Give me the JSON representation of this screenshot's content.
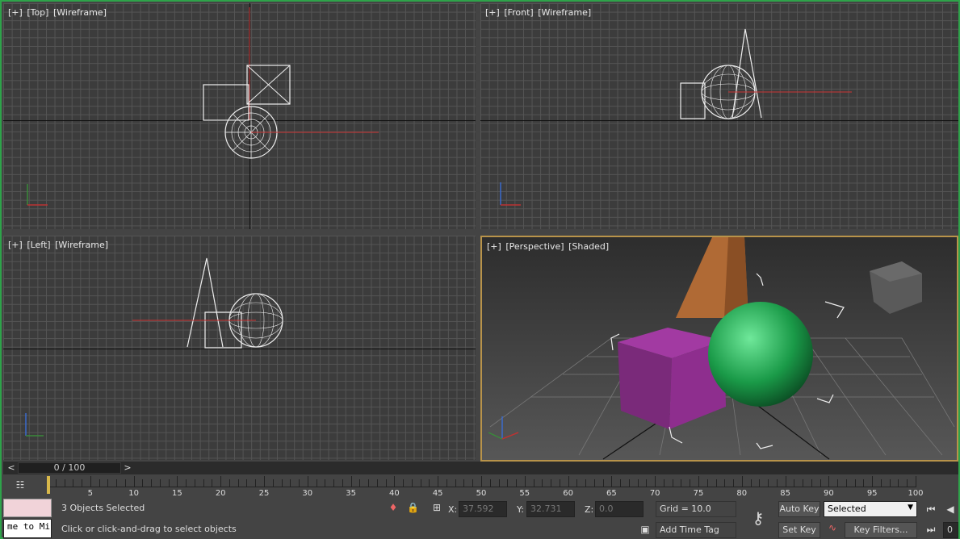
{
  "viewports": {
    "top": {
      "plus": "[+]",
      "name": "[Top]",
      "mode": "[Wireframe]"
    },
    "front": {
      "plus": "[+]",
      "name": "[Front]",
      "mode": "[Wireframe]"
    },
    "left": {
      "plus": "[+]",
      "name": "[Left]",
      "mode": "[Wireframe]"
    },
    "perspective": {
      "plus": "[+]",
      "name": "[Perspective]",
      "mode": "[Shaded]"
    }
  },
  "timeline": {
    "prev": "<",
    "next": ">",
    "frame": "0 / 100",
    "ticks": [
      "5",
      "10",
      "15",
      "20",
      "25",
      "30",
      "35",
      "40",
      "45",
      "50",
      "55",
      "60",
      "65",
      "70",
      "75",
      "80",
      "85",
      "90",
      "95",
      "100"
    ]
  },
  "status": {
    "maxscript_text": "me to Mi",
    "selection": "3 Objects Selected",
    "prompt": "Click or click-and-drag to select objects",
    "x_label": "X:",
    "x_value": "37.592",
    "y_label": "Y:",
    "y_value": "32.731",
    "z_label": "Z:",
    "z_value": "0.0",
    "grid": "Grid = 10.0",
    "add_time_tag": "Add Time Tag",
    "auto_key": "Auto Key",
    "set_key": "Set Key",
    "key_mode": "Selected",
    "key_filters": "Key Filters...",
    "frame_field": "0"
  },
  "colors": {
    "viewport_border_active": "#b8934a",
    "box": "#8e2e8e",
    "sphere": "#1a9a48",
    "cone": "#b06a35"
  }
}
